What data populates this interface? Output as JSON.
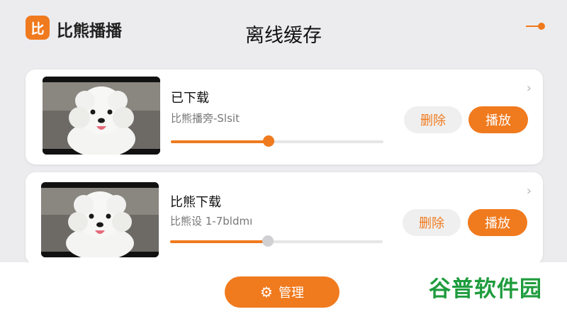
{
  "header": {
    "logo_glyph": "比",
    "app_name": "比熊播播",
    "page_title": "离线缓存",
    "control_icon": "slider-toggle-icon"
  },
  "items": [
    {
      "title": "已下载",
      "subtitle": "比熊播旁-Slsit",
      "progress": 0.46,
      "knob": "orange",
      "delete_label": "删除",
      "play_label": "播放"
    },
    {
      "title": "比熊下载",
      "subtitle": "比熊设 1-7bldmı",
      "progress": 0.46,
      "knob": "grey",
      "delete_label": "删除",
      "play_label": "播放"
    }
  ],
  "footer": {
    "manage_label": "管理",
    "manage_icon": "gear-icon"
  },
  "watermark": "谷普软件园",
  "colors": {
    "accent": "#f07a1e",
    "watermark": "#1e9c3d"
  }
}
